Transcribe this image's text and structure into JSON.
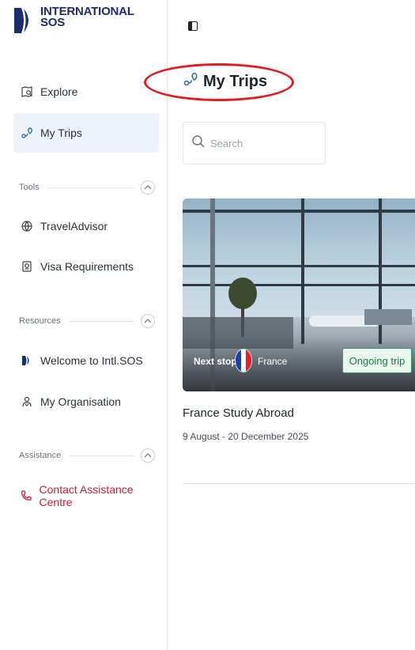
{
  "brand": {
    "line1": "INTERNATIONAL",
    "line2": "SOS",
    "color": "#1a2e6b"
  },
  "nav": {
    "explore": "Explore",
    "my_trips": "My Trips"
  },
  "sections": {
    "tools": "Tools",
    "resources": "Resources",
    "assistance": "Assistance"
  },
  "tools": {
    "travel_advisor": "TravelAdvisor",
    "visa": "Visa Requirements"
  },
  "resources": {
    "welcome": "Welcome to Intl.SOS",
    "organisation": "My Organisation"
  },
  "assistance": {
    "contact": "Contact Assistance Centre",
    "color": "#c4203a"
  },
  "main": {
    "title": "My Trips",
    "search_placeholder": "Search",
    "trip": {
      "next_stop_label": "Next stop",
      "country": "France",
      "status": "Ongoing trip",
      "name": "France Study Abroad",
      "dates": "9 August - 20 December 2025"
    }
  },
  "icons": [
    "map-book-icon",
    "route-pin-icon",
    "globe-person-icon",
    "passport-icon",
    "sos-logo-icon",
    "people-icon",
    "phone-icon",
    "search-icon",
    "chevron-up-icon",
    "panel-toggle-icon"
  ],
  "colors": {
    "active_bg": "#eef3fb",
    "accent_red": "#e01b22",
    "status_green": "#1d7a45"
  }
}
